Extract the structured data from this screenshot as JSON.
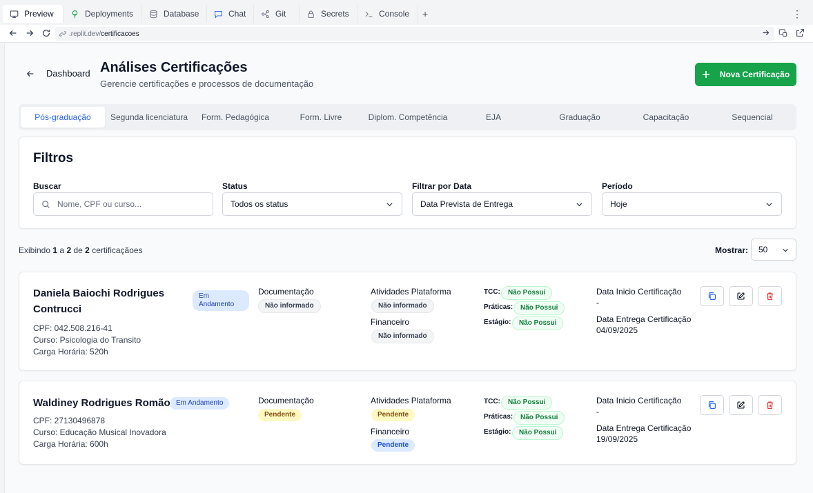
{
  "browser": {
    "tabs": [
      {
        "label": "Preview",
        "icon": "monitor-icon"
      },
      {
        "label": "Deployments",
        "icon": "deploy-icon"
      },
      {
        "label": "Database",
        "icon": "database-icon"
      },
      {
        "label": "Chat",
        "icon": "chat-icon"
      },
      {
        "label": "Git",
        "icon": "git-icon"
      },
      {
        "label": "Secrets",
        "icon": "lock-icon"
      },
      {
        "label": "Console",
        "icon": "terminal-icon"
      }
    ],
    "url_host": ".replit.dev/",
    "url_path": "certificacoes"
  },
  "header": {
    "back_label": "Dashboard",
    "title": "Análises Certificações",
    "subtitle": "Gerencie certificações e processos de documentação",
    "new_button": "Nova Certificação"
  },
  "categories": [
    "Pós-graduação",
    "Segunda licenciatura",
    "Form. Pedagógica",
    "Form. Livre",
    "Diplom. Competência",
    "EJA",
    "Graduação",
    "Capacitação",
    "Sequencial"
  ],
  "filters": {
    "title": "Filtros",
    "search_label": "Buscar",
    "search_placeholder": "Nome, CPF ou curso...",
    "status_label": "Status",
    "status_value": "Todos os status",
    "date_label": "Filtrar por Data",
    "date_value": "Data Prevista de Entrega",
    "period_label": "Período",
    "period_value": "Hoje"
  },
  "summary": {
    "prefix": "Exibindo",
    "from": "1",
    "mid": "a",
    "to": "2",
    "of": "de",
    "total": "2",
    "suffix": "certificaçãoes",
    "show_label": "Mostrar:",
    "show_value": "50"
  },
  "records": [
    {
      "name_line1": "Daniela Baiochi Rodrigues",
      "name_line2": "Contrucci",
      "status_line1": "Em",
      "status_line2": "Andamento",
      "cpf": "CPF: 042.508.216-41",
      "curso": "Curso: Psicologia do Transito",
      "carga": "Carga Horária: 520h",
      "doc_label": "Documentação",
      "doc_value": "Não informado",
      "ativ_label": "Atividades Plataforma",
      "ativ_value": "Não informado",
      "fin_label": "Financeiro",
      "fin_value": "Não informado",
      "tcc_label": "TCC:",
      "tcc_value": "Não Possui",
      "prat_label": "Práticas:",
      "prat_value": "Não Possui",
      "est_label": "Estágio:",
      "est_value": "Não Possui",
      "inicio_label": "Data Inicio Certificação",
      "inicio_value": "-",
      "entrega_label": "Data Entrega Certificação",
      "entrega_value": "04/09/2025"
    },
    {
      "name_line1": "Waldiney Rodrigues Romão",
      "status": "Em Andamento",
      "cpf": "CPF: 27130496878",
      "curso": "Curso: Educação Musical Inovadora",
      "carga": "Carga Horária: 600h",
      "doc_label": "Documentação",
      "doc_value": "Pendente",
      "ativ_label": "Atividades Plataforma",
      "ativ_value": "Pendente",
      "fin_label": "Financeiro",
      "fin_value": "Pendente",
      "tcc_label": "TCC:",
      "tcc_value": "Não Possui",
      "prat_label": "Práticas:",
      "prat_value": "Não Possui",
      "est_label": "Estágio:",
      "est_value": "Não Possui",
      "inicio_label": "Data Inicio Certificação",
      "inicio_value": "-",
      "entrega_label": "Data Entrega Certificação",
      "entrega_value": "19/09/2025"
    }
  ],
  "colors": {
    "primary_green": "#16a34a",
    "active_tab_blue": "#2563eb",
    "delete_red": "#dc2626"
  }
}
